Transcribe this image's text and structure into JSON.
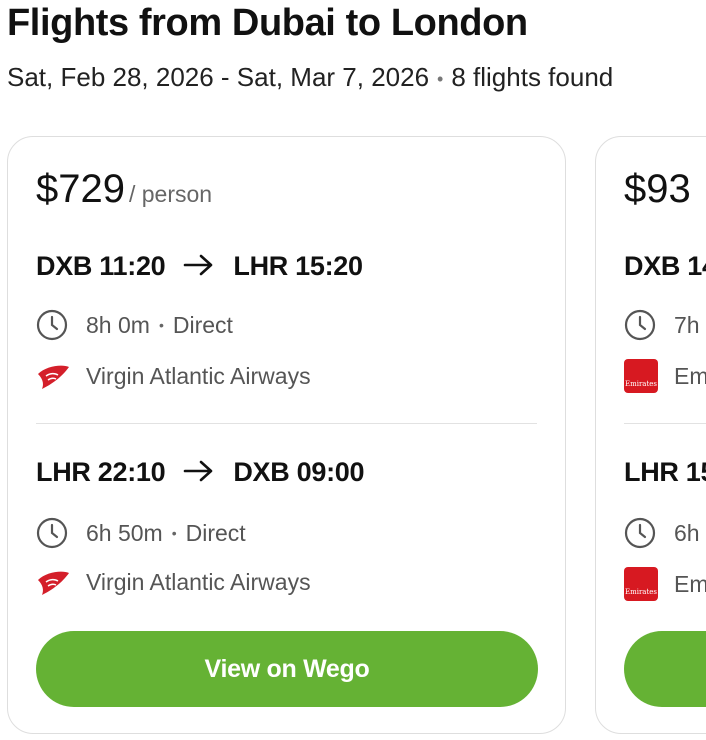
{
  "header": {
    "title": "Flights from Dubai to London",
    "dates": "Sat, Feb 28, 2026 - Sat, Mar 7, 2026",
    "separator": "•",
    "result_count": "8 flights found"
  },
  "colors": {
    "accent_green": "#65b234",
    "virgin_red": "#d41f2a",
    "emirates_red": "#d71921"
  },
  "flights": [
    {
      "price": "$729",
      "price_unit": "/ person",
      "outbound": {
        "route": "DXB 11:20",
        "route_to": "LHR 15:20",
        "duration": "8h 0m",
        "separator": "•",
        "stops": "Direct",
        "airline": "Virgin Atlantic Airways",
        "airline_icon": "virgin-atlantic-logo"
      },
      "inbound": {
        "route": "LHR 22:10",
        "route_to": "DXB 09:00",
        "duration": "6h 50m",
        "separator": "•",
        "stops": "Direct",
        "airline": "Virgin Atlantic Airways",
        "airline_icon": "virgin-atlantic-logo"
      },
      "cta": "View on Wego"
    },
    {
      "price": "$93",
      "outbound": {
        "route": "DXB 14",
        "duration": "7h",
        "airline": "Em",
        "airline_icon": "emirates-logo"
      },
      "inbound": {
        "route": "LHR 15",
        "duration": "6h",
        "airline": "Em",
        "airline_icon": "emirates-logo"
      }
    }
  ]
}
